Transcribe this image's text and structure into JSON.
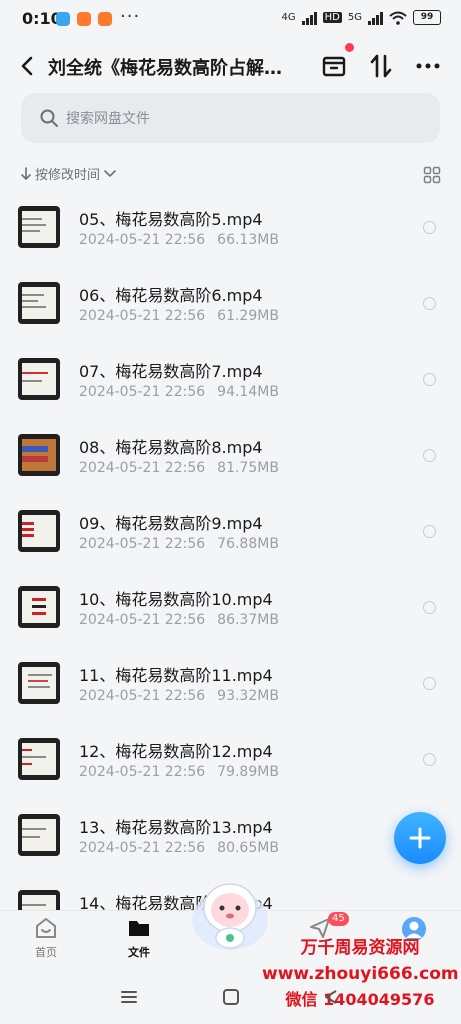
{
  "status_bar": {
    "time": "0:10",
    "network_1": "4G",
    "network_2": "5G",
    "hd": "HD",
    "battery": "99"
  },
  "header": {
    "title": "刘全统《梅花易数高阶占解…",
    "back_icon": "back-arrow-icon",
    "icons": [
      "archive-box-icon",
      "sort-updown-icon",
      "more-dots-icon"
    ]
  },
  "search": {
    "placeholder": "搜索网盘文件"
  },
  "sort": {
    "label": "按修改时间"
  },
  "files": [
    {
      "name": "05、梅花易数高阶5.mp4",
      "date": "2024-05-21  22:56",
      "size": "66.13MB"
    },
    {
      "name": "06、梅花易数高阶6.mp4",
      "date": "2024-05-21  22:56",
      "size": "61.29MB"
    },
    {
      "name": "07、梅花易数高阶7.mp4",
      "date": "2024-05-21  22:56",
      "size": "94.14MB"
    },
    {
      "name": "08、梅花易数高阶8.mp4",
      "date": "2024-05-21  22:56",
      "size": "81.75MB"
    },
    {
      "name": "09、梅花易数高阶9.mp4",
      "date": "2024-05-21  22:56",
      "size": "76.88MB"
    },
    {
      "name": "10、梅花易数高阶10.mp4",
      "date": "2024-05-21  22:56",
      "size": "86.37MB"
    },
    {
      "name": "11、梅花易数高阶11.mp4",
      "date": "2024-05-21  22:56",
      "size": "93.32MB"
    },
    {
      "name": "12、梅花易数高阶12.mp4",
      "date": "2024-05-21  22:56",
      "size": "79.89MB"
    },
    {
      "name": "13、梅花易数高阶13.mp4",
      "date": "2024-05-21  22:56",
      "size": "80.65MB"
    },
    {
      "name": "14、梅花易数高阶14.mp4",
      "date": "",
      "size": ""
    }
  ],
  "bottom_nav": {
    "home": "首页",
    "files": "文件",
    "share_badge": "45"
  },
  "watermark": {
    "line1": "万千周易资源网",
    "line2": "www.zhouyi666.com",
    "line3": "微信 1404049576"
  },
  "colors": {
    "accent": "#1b8cff",
    "badge": "#ff4d5a",
    "watermark": "#e0141e"
  }
}
